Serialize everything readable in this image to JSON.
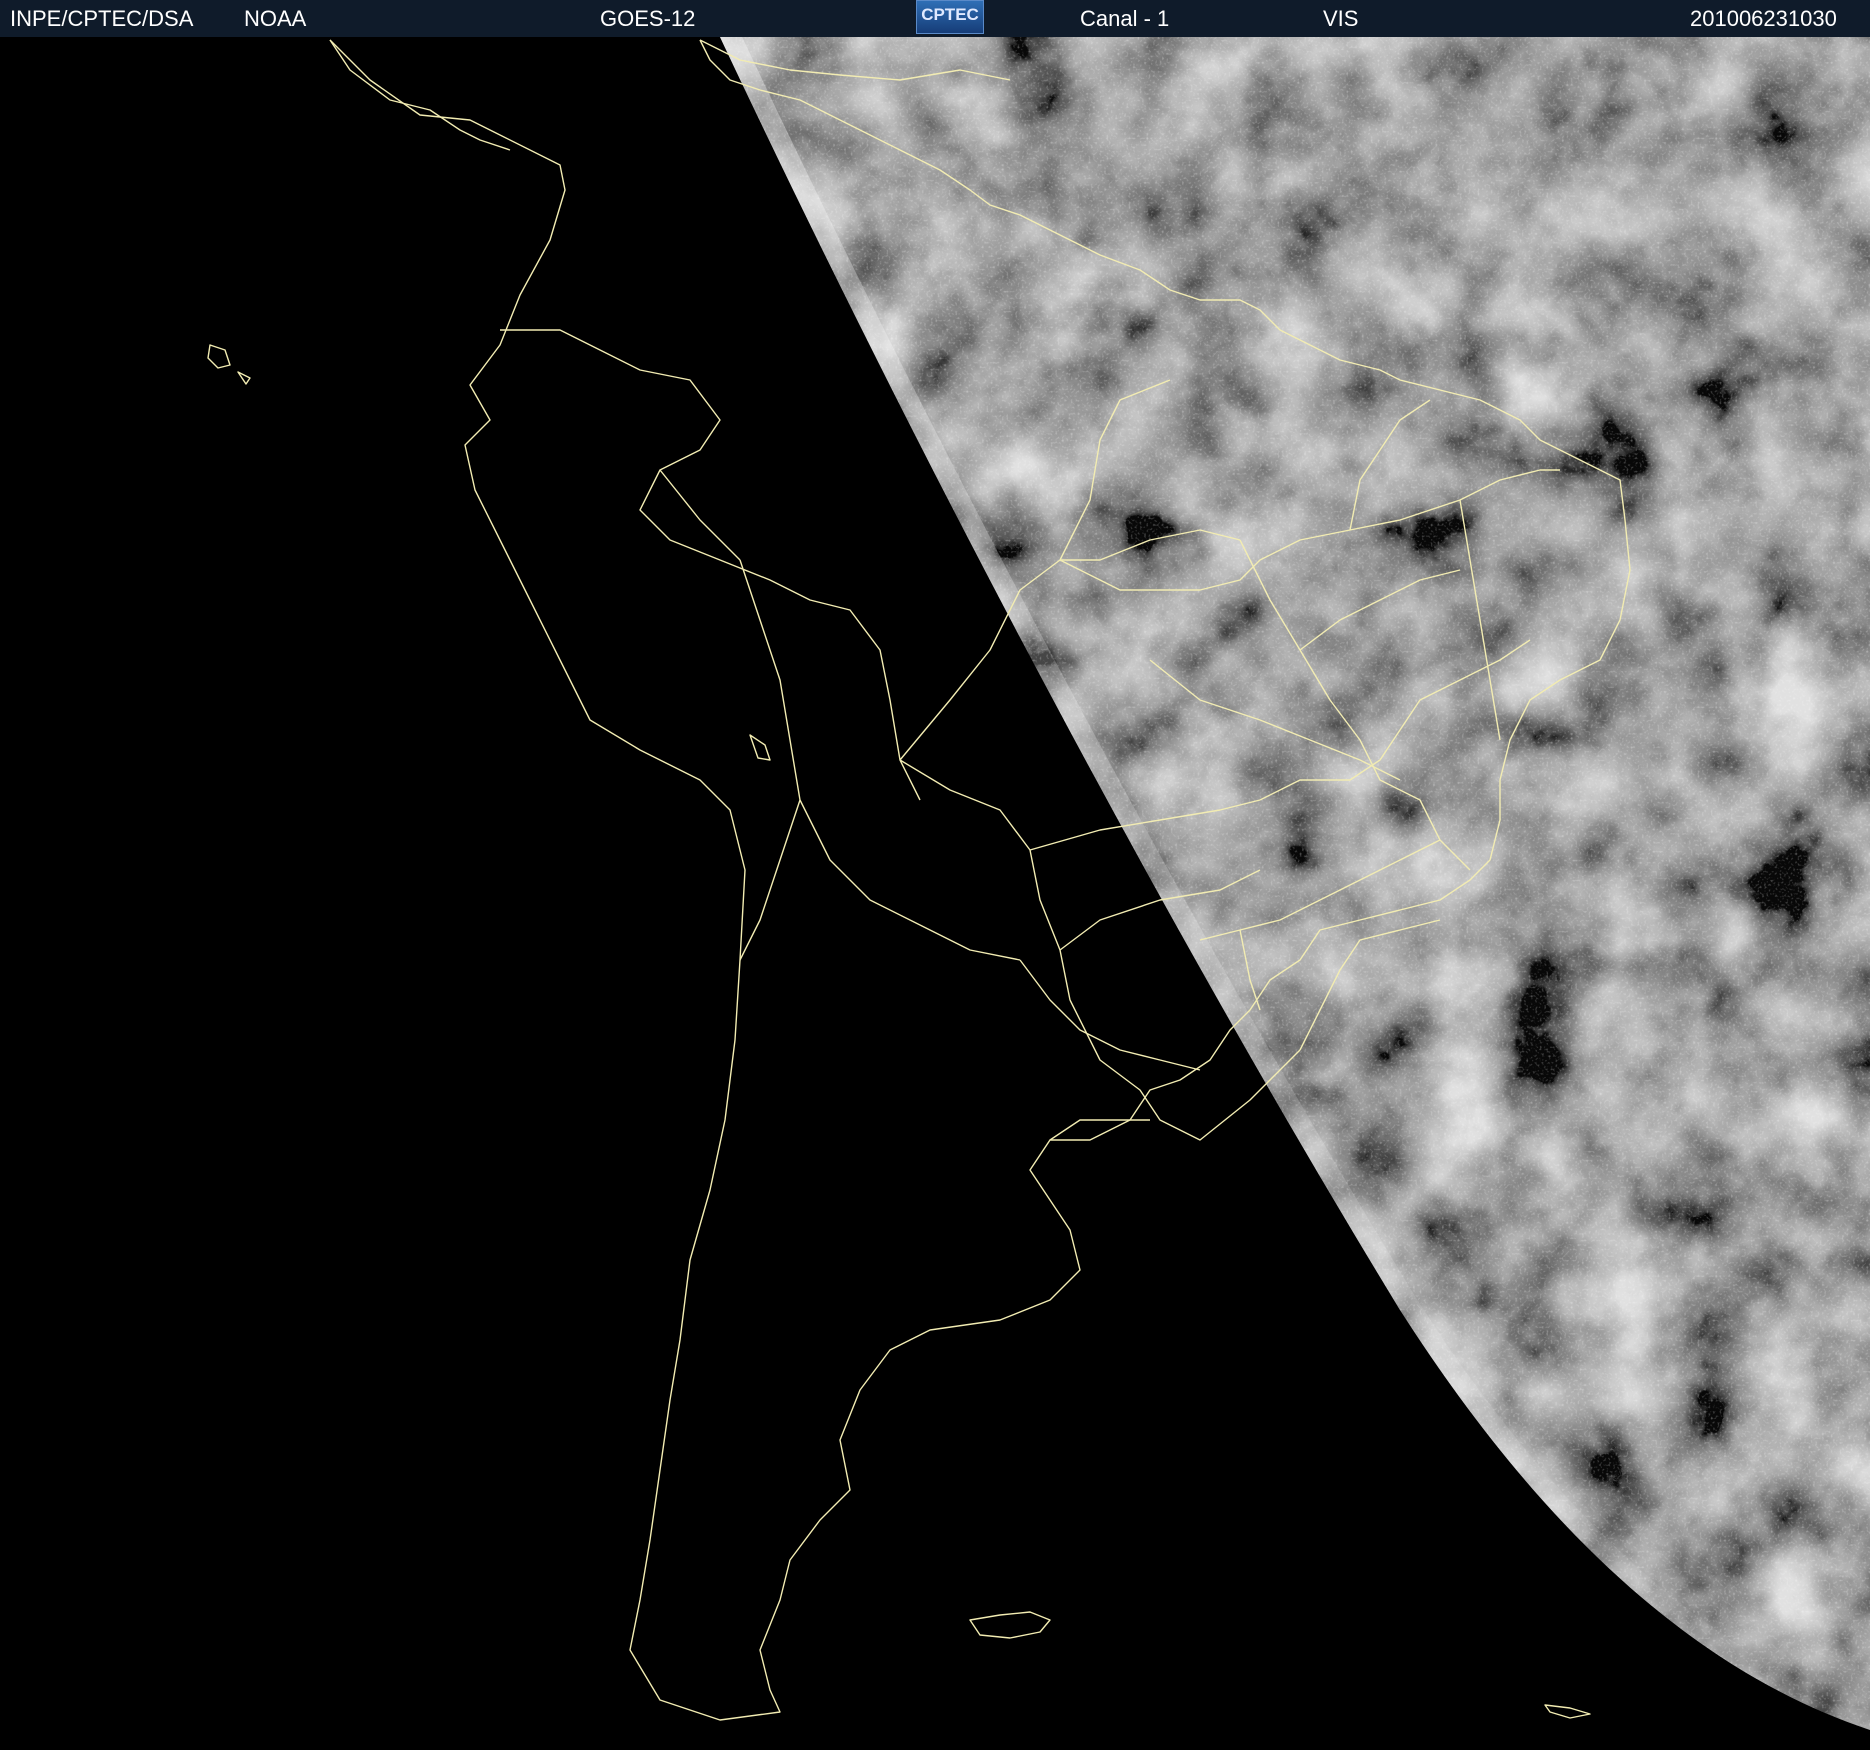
{
  "header": {
    "institution": "INPE/CPTEC/DSA",
    "agency": "NOAA",
    "satellite": "GOES-12",
    "logo_text": "CPTEC",
    "channel": "Canal - 1",
    "band": "VIS",
    "timestamp": "201006231030"
  },
  "colors": {
    "header_background": "#0f1b2a",
    "header_text": "#ffffff",
    "coastline": "#f2ecb2",
    "space": "#000000"
  }
}
